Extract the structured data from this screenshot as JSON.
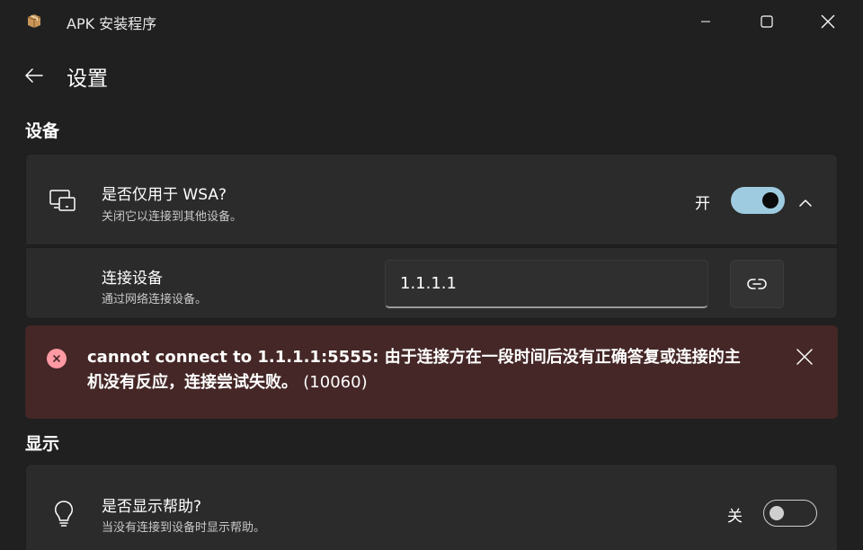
{
  "window": {
    "title": "APK 安装程序",
    "icon": "package-icon",
    "controls": [
      "minimize-icon",
      "maximize-icon",
      "close-icon"
    ]
  },
  "header": {
    "title": "设置",
    "back_icon": "back-arrow-icon"
  },
  "sections": {
    "device": {
      "title": "设备",
      "wsa_row": {
        "icon": "devices-icon",
        "title": "是否仅用于 WSA?",
        "description": "关闭它以连接到其他设备。",
        "toggle_label": "开",
        "toggle_on": true,
        "expanded": true
      },
      "connect_row": {
        "title": "连接设备",
        "description": "通过网络连接设备。",
        "input_value": "1.1.1.1",
        "button_icon": "link-icon"
      }
    },
    "error": {
      "message": "cannot connect to 1.1.1.1:5555: 由于连接方在一段时间后没有正确答复或连接的主机没有反应，连接尝试失败。",
      "code": "(10060)",
      "icon": "error-icon",
      "accent": "#ff99a4"
    },
    "display": {
      "title": "显示",
      "help_row": {
        "icon": "lightbulb-icon",
        "title": "是否显示帮助?",
        "description": "当没有连接到设备时显示帮助。",
        "toggle_label": "关",
        "toggle_on": false
      }
    }
  },
  "colors": {
    "background": "#202020",
    "card": "#2b2b2b",
    "toggle_on": "#9ecbe0",
    "error_background": "#442726"
  }
}
